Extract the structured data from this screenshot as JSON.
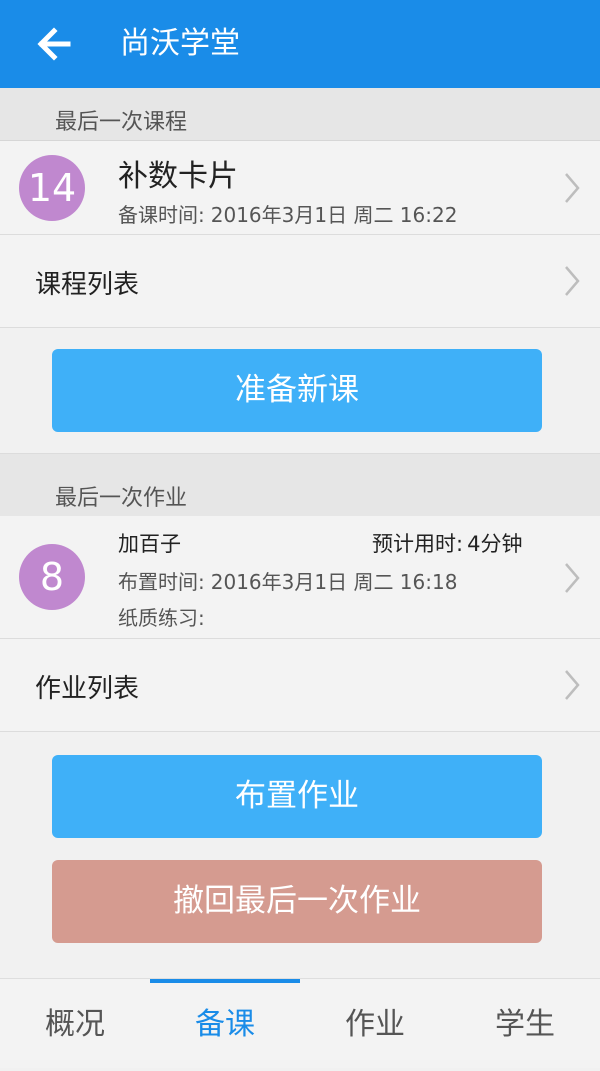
{
  "appbar": {
    "title": "尚沃学堂",
    "back_icon": "arrow-left-icon"
  },
  "last_lesson": {
    "header": "最后一次课程",
    "number": "14",
    "title": "补数卡片",
    "time_label": "备课时间:",
    "time_value": "2016年3月1日 周二 16:22"
  },
  "lesson_list": {
    "label": "课程列表"
  },
  "new_lesson_button": "准备新课",
  "last_homework": {
    "header": "最后一次作业",
    "number": "8",
    "title": "加百子",
    "estimate_label": "预计用时:",
    "estimate_value": "4分钟",
    "time_label": "布置时间:",
    "time_value": "2016年3月1日 周二 16:18",
    "paper_label": "纸质练习:"
  },
  "homework_list": {
    "label": "作业列表"
  },
  "assign_button": "布置作业",
  "revoke_button": "撤回最后一次作业",
  "tabs": [
    {
      "label": "概况",
      "active": false
    },
    {
      "label": "备课",
      "active": true
    },
    {
      "label": "作业",
      "active": false
    },
    {
      "label": "学生",
      "active": false
    }
  ],
  "colors": {
    "primary": "#1a8ce8",
    "button_blue": "#3fb0f8",
    "button_red": "#d59b90",
    "badge": "#c088cf"
  }
}
